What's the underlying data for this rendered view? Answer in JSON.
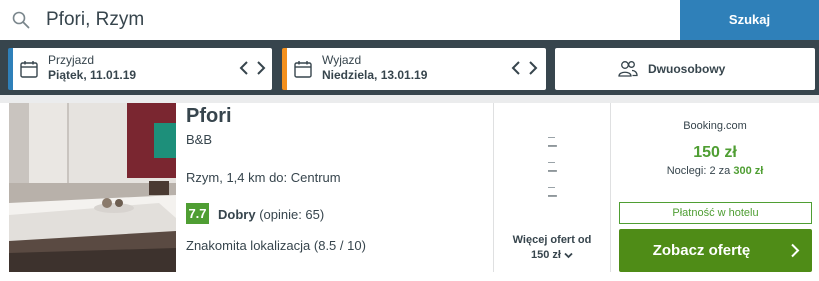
{
  "search": {
    "value": "Pfori, Rzym",
    "button_label": "Szukaj"
  },
  "checkin": {
    "label": "Przyjazd",
    "value": "Piątek, 11.01.19"
  },
  "checkout": {
    "label": "Wyjazd",
    "value": "Niedziela, 13.01.19"
  },
  "room": {
    "label": "Dwuosobowy"
  },
  "hotel": {
    "name": "Pfori",
    "type": "B&B",
    "location": "Rzym, 1,4 km do: Centrum",
    "rating_score": "7.7",
    "rating_word": "Dobry",
    "rating_reviews": "(opinie: 65)",
    "highlight": "Znakomita lokalizacja (8.5 / 10)"
  },
  "offers": {
    "dashes": [
      "–",
      "–",
      "–"
    ],
    "more_label": "Więcej ofert od",
    "more_price": "150 zł"
  },
  "deal": {
    "provider": "Booking.com",
    "price": "150 zł",
    "nights_prefix": "Noclegi: 2 za",
    "nights_total": "300 zł",
    "payment_badge": "Płatność w hotelu",
    "cta": "Zobacz ofertę"
  },
  "colors": {
    "topband": "#37454d",
    "search_button": "#2f80b9",
    "checkin_accent": "#2f80b9",
    "checkout_accent": "#f4901d",
    "rating_green": "#4f9e33",
    "cta_green": "#4f8c17"
  },
  "icons": {
    "search": "search-icon",
    "calendar": "calendar-icon",
    "prev": "chevron-left-icon",
    "next": "chevron-right-icon",
    "room": "people-icon",
    "more": "chevron-down-icon",
    "cta": "chevron-right-icon"
  }
}
